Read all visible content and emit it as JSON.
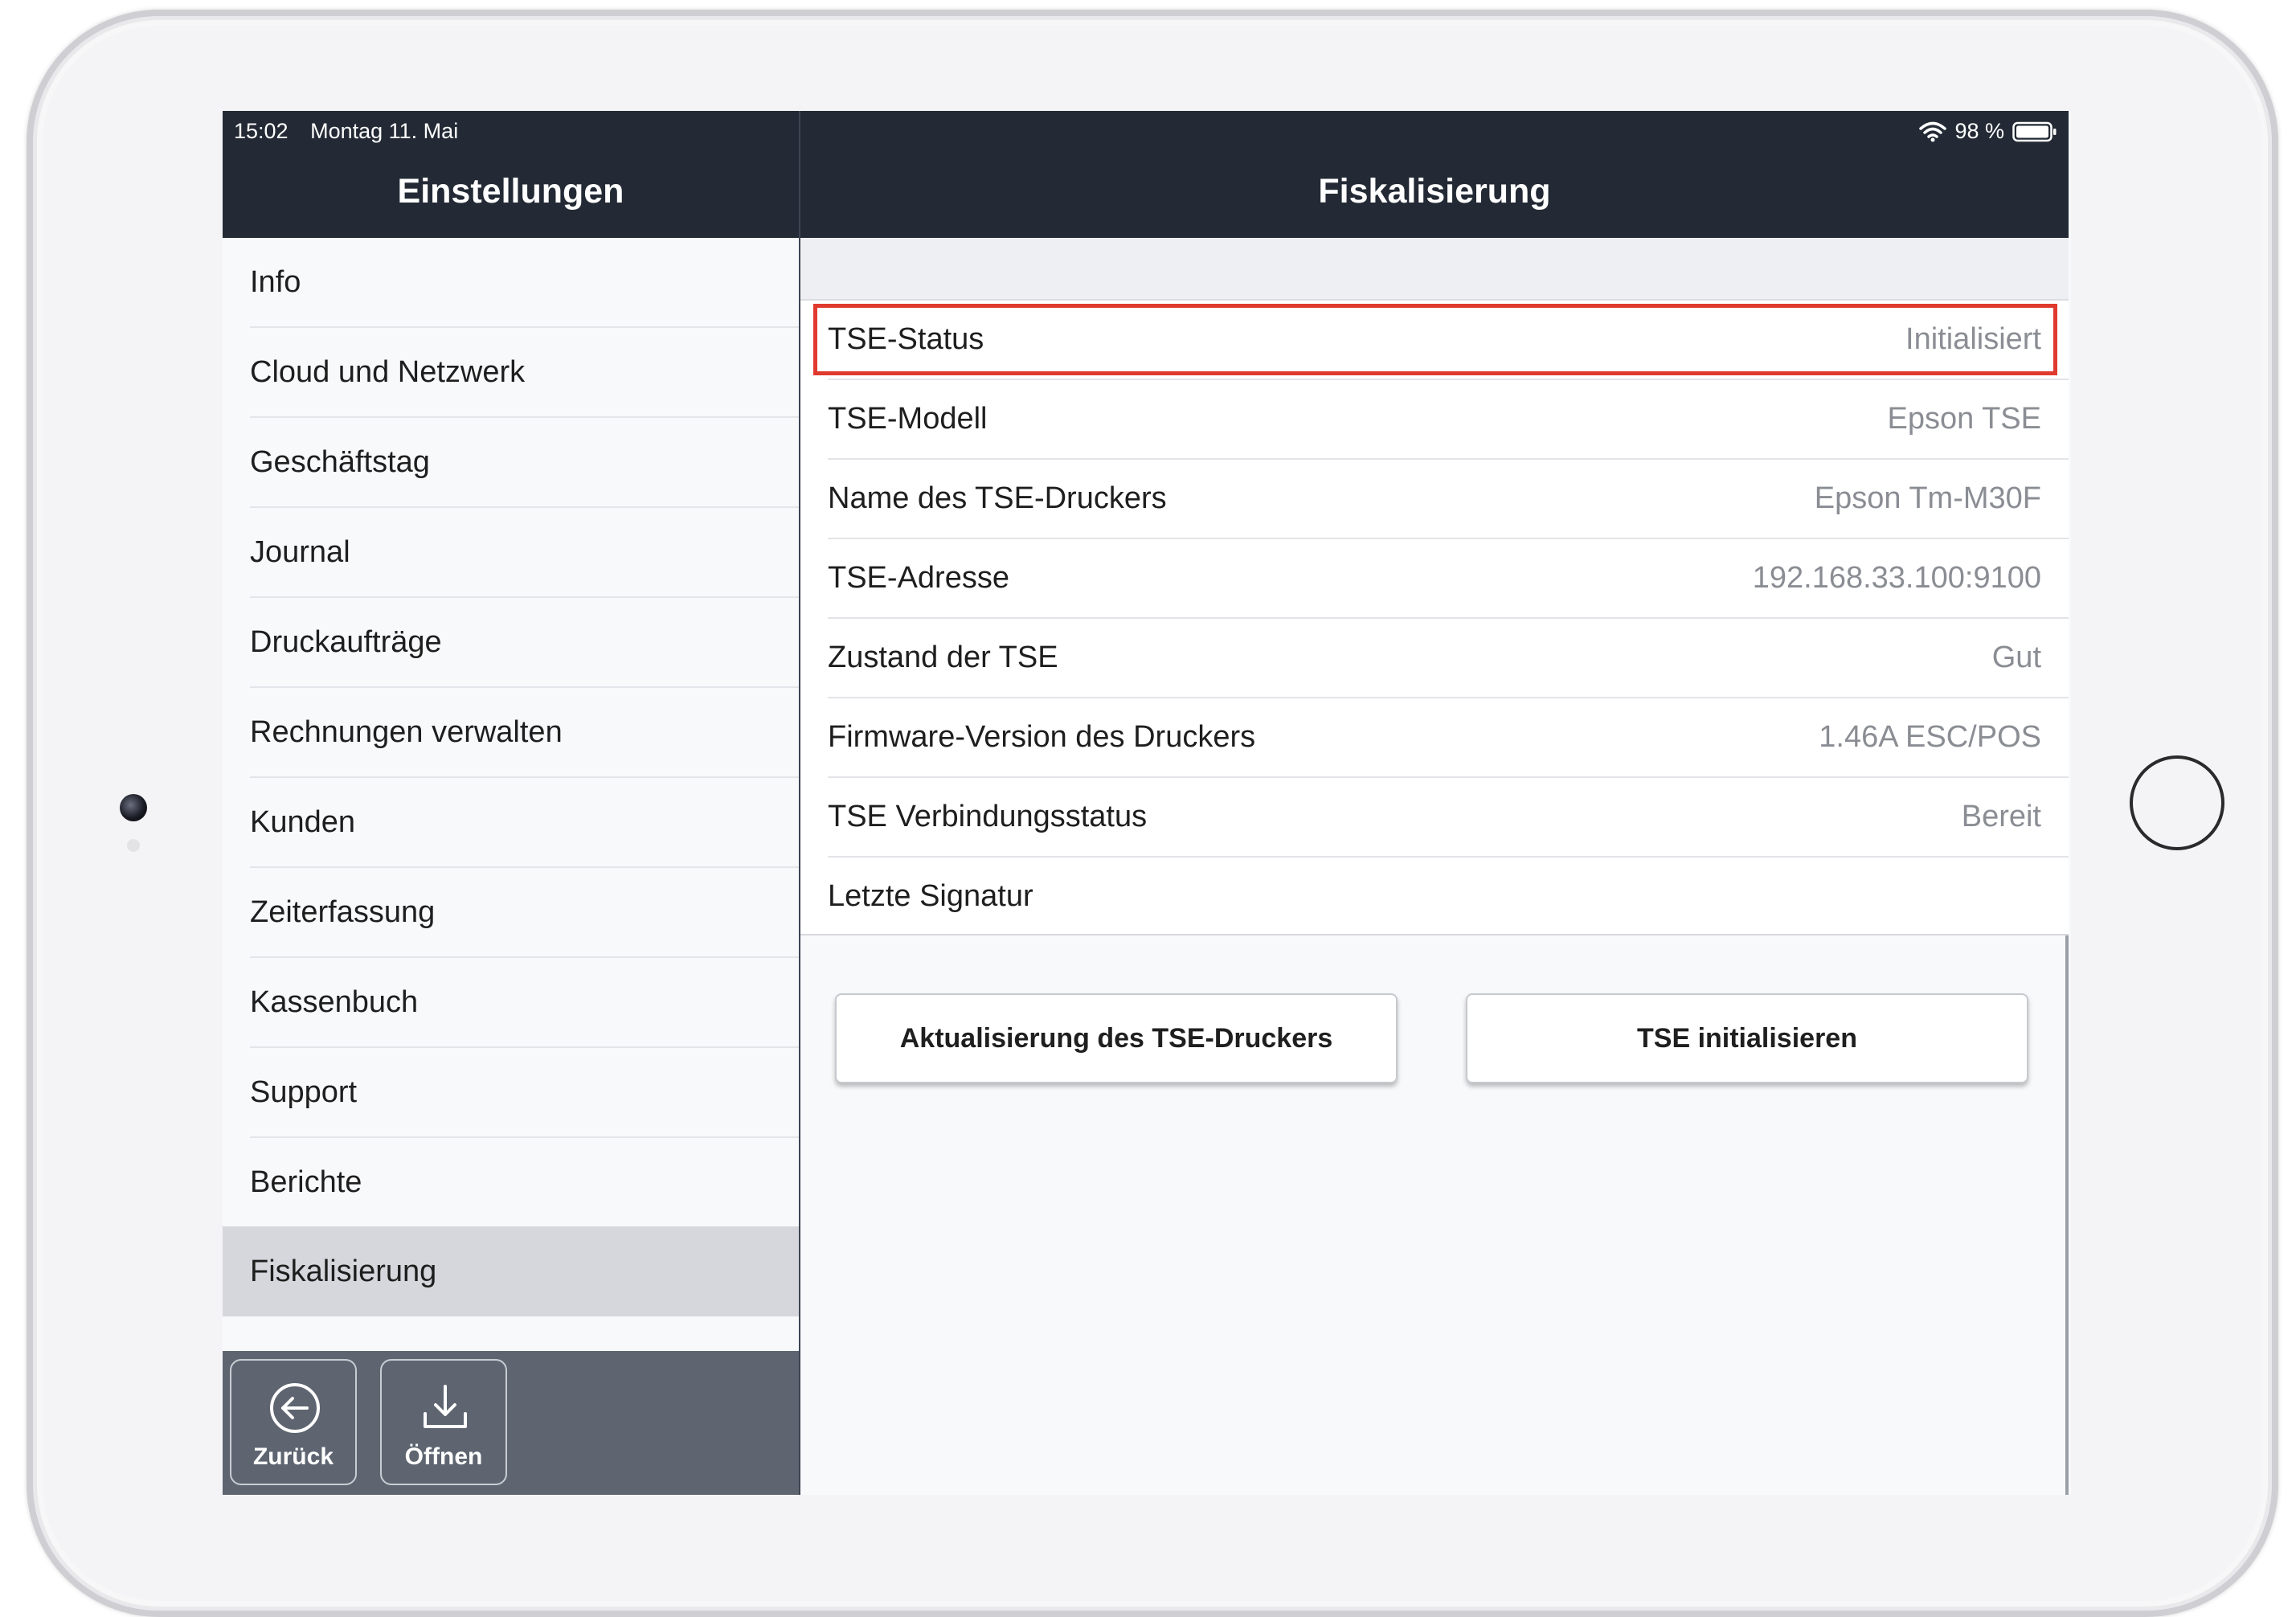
{
  "status_bar": {
    "time": "15:02",
    "date": "Montag 11. Mai",
    "battery_percent": "98 %",
    "wifi_icon": "wifi-icon",
    "battery_icon": "battery-icon"
  },
  "left": {
    "title": "Einstellungen",
    "menu": [
      {
        "label": "Info"
      },
      {
        "label": "Cloud und Netzwerk"
      },
      {
        "label": "Geschäftstag"
      },
      {
        "label": "Journal"
      },
      {
        "label": "Druckaufträge"
      },
      {
        "label": "Rechnungen verwalten"
      },
      {
        "label": "Kunden"
      },
      {
        "label": "Zeiterfassung"
      },
      {
        "label": "Kassenbuch"
      },
      {
        "label": "Support"
      },
      {
        "label": "Berichte"
      },
      {
        "label": "Fiskalisierung",
        "active": true
      }
    ],
    "toolbar": {
      "back_label": "Zurück",
      "back_icon": "arrow-left-circle-icon",
      "open_label": "Öffnen",
      "open_icon": "download-icon"
    }
  },
  "right": {
    "title": "Fiskalisierung",
    "rows": [
      {
        "label": "TSE-Status",
        "value": "Initialisiert",
        "highlighted": true
      },
      {
        "label": "TSE-Modell",
        "value": "Epson TSE"
      },
      {
        "label": "Name des TSE-Druckers",
        "value": "Epson Tm-M30F"
      },
      {
        "label": "TSE-Adresse",
        "value": "192.168.33.100:9100"
      },
      {
        "label": "Zustand der TSE",
        "value": "Gut"
      },
      {
        "label": "Firmware-Version des Druckers",
        "value": "1.46A ESC/POS"
      },
      {
        "label": "TSE Verbindungsstatus",
        "value": "Bereit"
      },
      {
        "label": "Letzte Signatur",
        "value": ""
      }
    ],
    "buttons": {
      "update_printer": "Aktualisierung des TSE-Druckers",
      "init_tse": "TSE initialisieren"
    }
  },
  "colors": {
    "navbar": "#232a35",
    "toolbar": "#5e6571",
    "highlight": "#e03a2f",
    "active_menu": "#d6d7dc"
  }
}
